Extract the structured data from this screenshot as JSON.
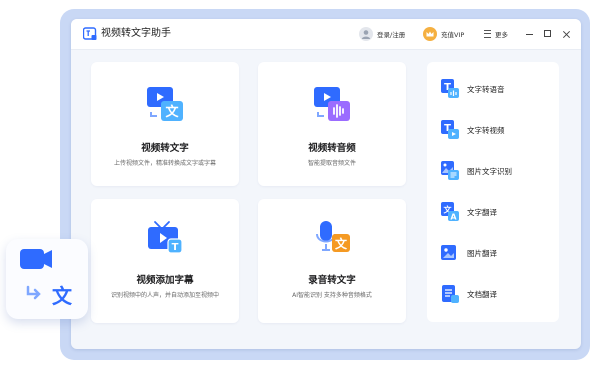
{
  "window": {
    "title": "视频转文字助手"
  },
  "header": {
    "login_label": "登录/注册",
    "vip_label": "充值VIP",
    "more_label": "更多"
  },
  "cards": [
    {
      "title": "视频转文字",
      "desc": "上传视频文件，精准转换成文字或字幕",
      "icon": "video-to-text-icon"
    },
    {
      "title": "视频转音频",
      "desc": "智能提取音频文件",
      "icon": "video-to-audio-icon"
    },
    {
      "title": "视频添加字幕",
      "desc": "识别视频中的人声，并自动添加至视频中",
      "icon": "video-subtitle-icon"
    },
    {
      "title": "录音转文字",
      "desc": "AI智能识别 支持多种音频格式",
      "icon": "recording-to-text-icon"
    }
  ],
  "sidebar": {
    "items": [
      {
        "label": "文字转语音",
        "icon": "text-to-speech-icon"
      },
      {
        "label": "文字转视频",
        "icon": "text-to-video-icon"
      },
      {
        "label": "图片文字识别",
        "icon": "image-ocr-icon"
      },
      {
        "label": "文字翻译",
        "icon": "text-translate-icon"
      },
      {
        "label": "图片翻译",
        "icon": "image-translate-icon"
      },
      {
        "label": "文档翻译",
        "icon": "document-translate-icon"
      }
    ]
  },
  "floating_badge": {
    "glyph": "文",
    "icon": "video-to-text-logo-icon"
  },
  "colors": {
    "brand_blue": "#2f6bff",
    "accent_orange": "#f59a23",
    "frame": "#c9d8f5"
  }
}
